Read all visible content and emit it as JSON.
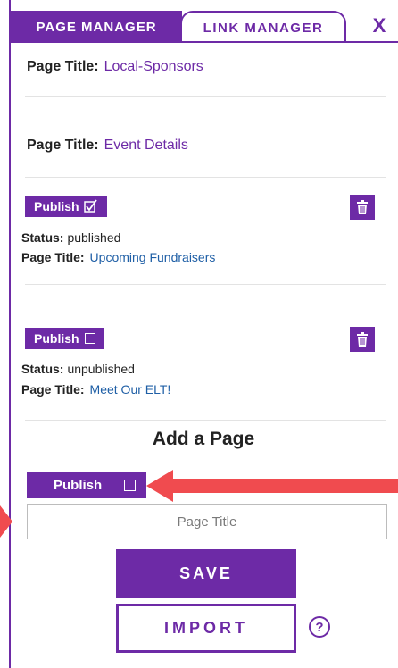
{
  "tabs": {
    "page_manager": "PAGE MANAGER",
    "link_manager": "LINK MANAGER",
    "close": "X"
  },
  "pages": [
    {
      "title_label": "Page Title:",
      "title": "Local-Sponsors"
    },
    {
      "title_label": "Page Title:",
      "title": "Event Details"
    },
    {
      "publish_label": "Publish",
      "checked": true,
      "status_label": "Status:",
      "status": "published",
      "title_label": "Page Title:",
      "title": "Upcoming Fundraisers"
    },
    {
      "publish_label": "Publish",
      "checked": false,
      "status_label": "Status:",
      "status": "unpublished",
      "title_label": "Page Title:",
      "title": "Meet Our ELT!"
    }
  ],
  "add_page": {
    "heading": "Add a Page",
    "publish_label": "Publish",
    "title_placeholder": "Page Title",
    "save_label": "SAVE",
    "import_label": "IMPORT",
    "help_label": "?"
  },
  "colors": {
    "accent": "#6d2aa6",
    "arrow": "#f04b4f",
    "link": "#1f5fa6"
  },
  "icons": {
    "trash": "trash-icon",
    "checkbox_checked": "checkbox-checked-icon",
    "checkbox_empty": "checkbox-empty-icon",
    "help": "help-icon",
    "close": "close-icon",
    "arrow": "arrow-annotation"
  }
}
